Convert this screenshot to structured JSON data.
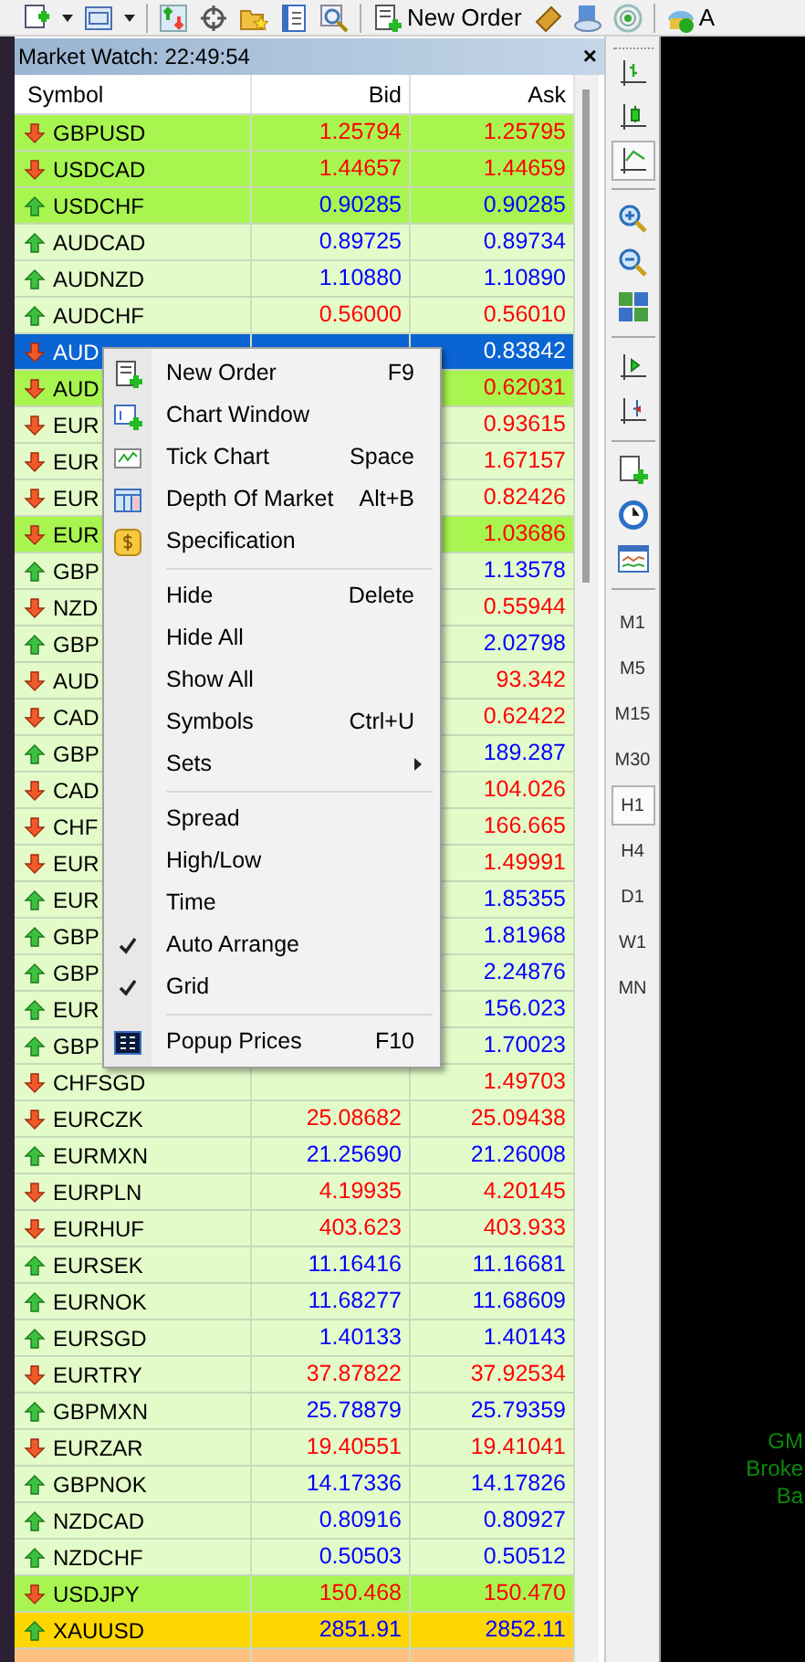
{
  "toolbar": {
    "new_order": "New Order",
    "cut_label": "A"
  },
  "market_watch": {
    "title": "Market Watch: 22:49:54",
    "close": "×",
    "columns": [
      "Symbol",
      "Bid",
      "Ask"
    ],
    "rows": [
      {
        "symbol": "GBPUSD",
        "bid": "1.25794",
        "ask": "1.25795",
        "up": false,
        "tick_up": false,
        "color": "#a8f550",
        "selected": false
      },
      {
        "symbol": "USDCAD",
        "bid": "1.44657",
        "ask": "1.44659",
        "up": false,
        "tick_up": false,
        "color": "#a8f550",
        "selected": false
      },
      {
        "symbol": "USDCHF",
        "bid": "0.90285",
        "ask": "0.90285",
        "up": true,
        "tick_up": true,
        "color": "#a8f550",
        "selected": false
      },
      {
        "symbol": "AUDCAD",
        "bid": "0.89725",
        "ask": "0.89734",
        "up": true,
        "tick_up": true,
        "color": "#e3fbc9",
        "selected": false
      },
      {
        "symbol": "AUDNZD",
        "bid": "1.10880",
        "ask": "1.10890",
        "up": true,
        "tick_up": true,
        "color": "#e3fbc9",
        "selected": false
      },
      {
        "symbol": "AUDCHF",
        "bid": "0.56000",
        "ask": "0.56010",
        "up": true,
        "tick_up": false,
        "color": "#e3fbc9",
        "selected": false
      },
      {
        "symbol": "AUD",
        "ask": "0.83842",
        "up": false,
        "selected": true
      },
      {
        "symbol": "AUD",
        "ask": "0.62031",
        "up": false,
        "tick_up": false,
        "color": "#a8f550",
        "selected": false
      },
      {
        "symbol": "EUR",
        "ask": "0.93615",
        "up": false,
        "tick_up": false,
        "color": "#e3fbc9",
        "selected": false
      },
      {
        "symbol": "EUR",
        "ask": "1.67157",
        "up": false,
        "tick_up": false,
        "color": "#e3fbc9",
        "selected": false
      },
      {
        "symbol": "EUR",
        "ask": "0.82426",
        "up": false,
        "tick_up": false,
        "color": "#e3fbc9",
        "selected": false
      },
      {
        "symbol": "EUR",
        "ask": "1.03686",
        "up": false,
        "tick_up": false,
        "color": "#a8f550",
        "selected": false
      },
      {
        "symbol": "GBP",
        "ask": "1.13578",
        "up": true,
        "tick_up": true,
        "color": "#e3fbc9",
        "selected": false
      },
      {
        "symbol": "NZD",
        "ask": "0.55944",
        "up": false,
        "tick_up": false,
        "color": "#e3fbc9",
        "selected": false
      },
      {
        "symbol": "GBP",
        "ask": "2.02798",
        "up": true,
        "tick_up": true,
        "color": "#e3fbc9",
        "selected": false
      },
      {
        "symbol": "AUD",
        "ask": "93.342",
        "up": false,
        "tick_up": false,
        "color": "#e3fbc9",
        "selected": false
      },
      {
        "symbol": "CAD",
        "ask": "0.62422",
        "up": false,
        "tick_up": false,
        "color": "#e3fbc9",
        "selected": false
      },
      {
        "symbol": "GBP",
        "ask": "189.287",
        "up": true,
        "tick_up": true,
        "color": "#e3fbc9",
        "selected": false
      },
      {
        "symbol": "CAD",
        "ask": "104.026",
        "up": false,
        "tick_up": false,
        "color": "#e3fbc9",
        "selected": false
      },
      {
        "symbol": "CHF",
        "ask": "166.665",
        "up": false,
        "tick_up": false,
        "color": "#e3fbc9",
        "selected": false
      },
      {
        "symbol": "EUR",
        "ask": "1.49991",
        "up": false,
        "tick_up": false,
        "color": "#e3fbc9",
        "selected": false
      },
      {
        "symbol": "EUR",
        "ask": "1.85355",
        "up": true,
        "tick_up": true,
        "color": "#e3fbc9",
        "selected": false
      },
      {
        "symbol": "GBP",
        "ask": "1.81968",
        "up": true,
        "tick_up": true,
        "color": "#e3fbc9",
        "selected": false
      },
      {
        "symbol": "GBP",
        "ask": "2.24876",
        "up": true,
        "tick_up": true,
        "color": "#e3fbc9",
        "selected": false
      },
      {
        "symbol": "EUR",
        "ask": "156.023",
        "up": true,
        "tick_up": true,
        "color": "#e3fbc9",
        "selected": false
      },
      {
        "symbol": "GBP",
        "ask": "1.70023",
        "up": true,
        "tick_up": true,
        "color": "#e3fbc9",
        "selected": false
      },
      {
        "symbol": "CHFSGD",
        "ask": "1.49703",
        "up": false,
        "tick_up": false,
        "color": "#e3fbc9",
        "selected": false
      },
      {
        "symbol": "EURCZK",
        "bid": "25.08682",
        "ask": "25.09438",
        "up": false,
        "tick_up": false,
        "color": "#e3fbc9",
        "selected": false
      },
      {
        "symbol": "EURMXN",
        "bid": "21.25690",
        "ask": "21.26008",
        "up": true,
        "tick_up": true,
        "color": "#e3fbc9",
        "selected": false
      },
      {
        "symbol": "EURPLN",
        "bid": "4.19935",
        "ask": "4.20145",
        "up": false,
        "tick_up": false,
        "color": "#e3fbc9",
        "selected": false
      },
      {
        "symbol": "EURHUF",
        "bid": "403.623",
        "ask": "403.933",
        "up": false,
        "tick_up": false,
        "color": "#e3fbc9",
        "selected": false
      },
      {
        "symbol": "EURSEK",
        "bid": "11.16416",
        "ask": "11.16681",
        "up": true,
        "tick_up": true,
        "color": "#e3fbc9",
        "selected": false
      },
      {
        "symbol": "EURNOK",
        "bid": "11.68277",
        "ask": "11.68609",
        "up": true,
        "tick_up": true,
        "color": "#e3fbc9",
        "selected": false
      },
      {
        "symbol": "EURSGD",
        "bid": "1.40133",
        "ask": "1.40143",
        "up": true,
        "tick_up": true,
        "color": "#e3fbc9",
        "selected": false
      },
      {
        "symbol": "EURTRY",
        "bid": "37.87822",
        "ask": "37.92534",
        "up": false,
        "tick_up": false,
        "color": "#e3fbc9",
        "selected": false
      },
      {
        "symbol": "GBPMXN",
        "bid": "25.78879",
        "ask": "25.79359",
        "up": true,
        "tick_up": true,
        "color": "#e3fbc9",
        "selected": false
      },
      {
        "symbol": "EURZAR",
        "bid": "19.40551",
        "ask": "19.41041",
        "up": false,
        "tick_up": false,
        "color": "#e3fbc9",
        "selected": false
      },
      {
        "symbol": "GBPNOK",
        "bid": "14.17336",
        "ask": "14.17826",
        "up": true,
        "tick_up": true,
        "color": "#e3fbc9",
        "selected": false
      },
      {
        "symbol": "NZDCAD",
        "bid": "0.80916",
        "ask": "0.80927",
        "up": true,
        "tick_up": true,
        "color": "#e3fbc9",
        "selected": false
      },
      {
        "symbol": "NZDCHF",
        "bid": "0.50503",
        "ask": "0.50512",
        "up": true,
        "tick_up": true,
        "color": "#e3fbc9",
        "selected": false
      },
      {
        "symbol": "USDJPY",
        "bid": "150.468",
        "ask": "150.470",
        "up": false,
        "tick_up": false,
        "color": "#a8f550",
        "selected": false
      },
      {
        "symbol": "XAUUSD",
        "bid": "2851.91",
        "ask": "2852.11",
        "up": true,
        "tick_up": true,
        "color": "#ffd700",
        "selected": false
      },
      {
        "color": "#ffc080",
        "selected": false
      }
    ]
  },
  "context_menu": {
    "items": [
      {
        "kind": "item",
        "label": "New Order",
        "shortcut": "F9"
      },
      {
        "kind": "item",
        "label": "Chart Window"
      },
      {
        "kind": "item",
        "label": "Tick Chart",
        "shortcut": "Space"
      },
      {
        "kind": "item",
        "label": "Depth Of Market",
        "shortcut": "Alt+B"
      },
      {
        "kind": "item",
        "label": "Specification"
      },
      {
        "kind": "separator"
      },
      {
        "kind": "item",
        "label": "Hide",
        "shortcut": "Delete"
      },
      {
        "kind": "item",
        "label": "Hide All"
      },
      {
        "kind": "item",
        "label": "Show All"
      },
      {
        "kind": "item",
        "label": "Symbols",
        "shortcut": "Ctrl+U"
      },
      {
        "kind": "submenu",
        "label": "Sets"
      },
      {
        "kind": "separator"
      },
      {
        "kind": "check",
        "label": "Spread",
        "checked": false
      },
      {
        "kind": "check",
        "label": "High/Low",
        "checked": false
      },
      {
        "kind": "check",
        "label": "Time",
        "checked": false
      },
      {
        "kind": "check",
        "label": "Auto Arrange",
        "checked": true
      },
      {
        "kind": "check",
        "label": "Grid",
        "checked": true
      },
      {
        "kind": "separator"
      },
      {
        "kind": "item",
        "label": "Popup Prices",
        "shortcut": "F10"
      }
    ]
  },
  "chart_tools": [
    {
      "kind": "bars",
      "selected": false
    },
    {
      "kind": "candles",
      "selected": false
    },
    {
      "kind": "line",
      "selected": true
    }
  ],
  "timeframes": [
    {
      "label": "M1",
      "selected": false
    },
    {
      "label": "M5",
      "selected": false
    },
    {
      "label": "M15",
      "selected": false
    },
    {
      "label": "M30",
      "selected": false
    },
    {
      "label": "H1",
      "selected": true
    },
    {
      "label": "H4",
      "selected": false
    },
    {
      "label": "D1",
      "selected": false
    },
    {
      "label": "W1",
      "selected": false
    },
    {
      "label": "MN",
      "selected": false
    }
  ],
  "chart_text": [
    "GM",
    "Broke",
    "Ba"
  ]
}
